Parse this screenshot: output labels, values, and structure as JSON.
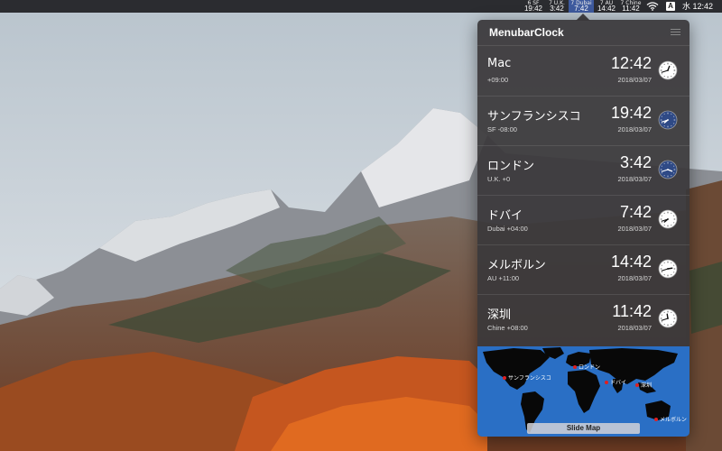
{
  "menubar": {
    "clocks": [
      {
        "day": "6 SF",
        "time": "19:42",
        "active": false
      },
      {
        "day": "7 U.K.",
        "time": "3:42",
        "active": false
      },
      {
        "day": "7 Dubai",
        "time": "7:42",
        "active": true
      },
      {
        "day": "7 AU",
        "time": "14:42",
        "active": false
      },
      {
        "day": "7 Chine",
        "time": "11:42",
        "active": false
      }
    ],
    "input_source": "A",
    "datetime": "水 12:42"
  },
  "panel": {
    "title": "MenubarClock",
    "rows": [
      {
        "name": "Mac",
        "offset": "+09:00",
        "time": "12:42",
        "date": "2018/03/07"
      },
      {
        "name": "サンフランシスコ",
        "offset": "SF -08:00",
        "time": "19:42",
        "date": "2018/03/07"
      },
      {
        "name": "ロンドン",
        "offset": "U.K. +0",
        "time": "3:42",
        "date": "2018/03/07"
      },
      {
        "name": "ドバイ",
        "offset": "Dubai +04:00",
        "time": "7:42",
        "date": "2018/03/07"
      },
      {
        "name": "メルボルン",
        "offset": "AU +11:00",
        "time": "14:42",
        "date": "2018/03/07"
      },
      {
        "name": "深圳",
        "offset": "Chine +08:00",
        "time": "11:42",
        "date": "2018/03/07"
      }
    ],
    "map": {
      "labels": [
        {
          "text": "サンフランシスコ"
        },
        {
          "text": "ロンドン"
        },
        {
          "text": "ドバイ"
        },
        {
          "text": "深圳"
        },
        {
          "text": "メルボルン"
        }
      ],
      "slide_label": "Slide Map"
    }
  },
  "colors": {
    "menubar": "#2b2c30",
    "panel": "#3a383a",
    "map_ocean": "#2a6fc5",
    "city_dot": "#e02020",
    "active_clock": "#3e5a9e"
  }
}
